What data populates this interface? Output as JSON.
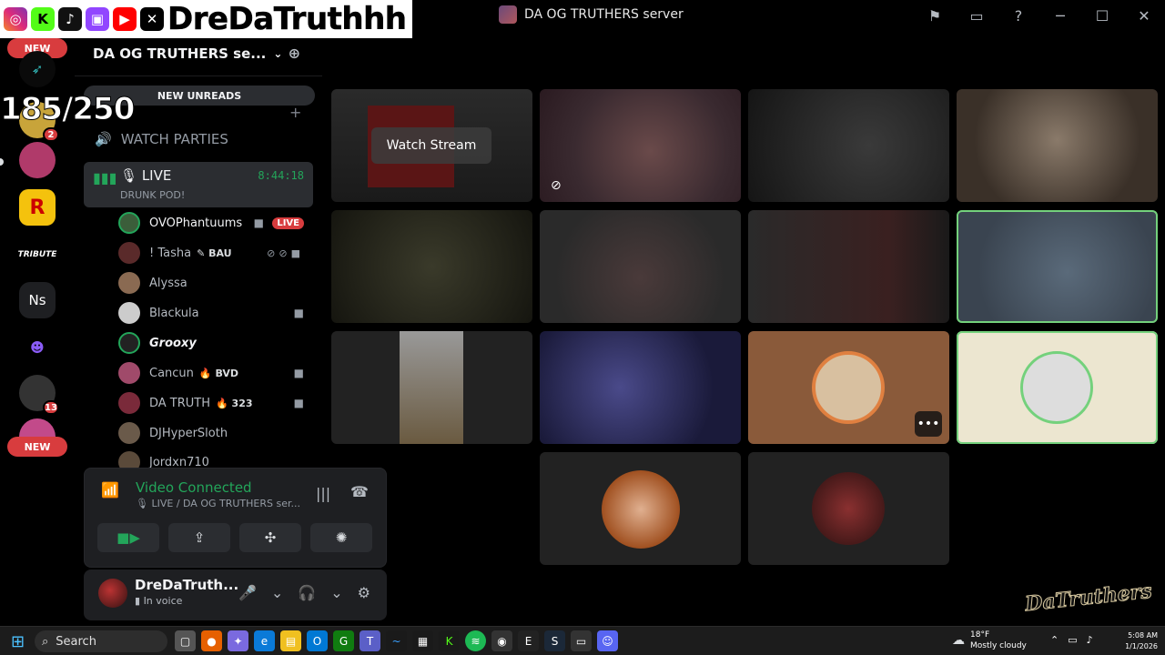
{
  "overlay": {
    "brand_name": "DreDaTruthhh",
    "socials": [
      {
        "icon": "instagram-icon",
        "label": "IG",
        "color": "#d6249f"
      },
      {
        "icon": "kick-icon",
        "label": "K",
        "color": "#53fc18"
      },
      {
        "icon": "tiktok-icon",
        "label": "♪",
        "color": "#111111"
      },
      {
        "icon": "twitch-icon",
        "label": "t",
        "color": "#9146ff"
      },
      {
        "icon": "youtube-icon",
        "label": "▶",
        "color": "#ff0000"
      },
      {
        "icon": "x-icon",
        "label": "𝕏",
        "color": "#000000"
      }
    ],
    "viewer_count": "185/250"
  },
  "window": {
    "title": "DA OG TRUTHERS server"
  },
  "rail": {
    "new_top": "NEW",
    "new_bottom": "NEW",
    "badges": [
      "2",
      "13"
    ],
    "items": [
      "Ns",
      "TRIBUTE"
    ]
  },
  "sidebar": {
    "server_name": "DA OG TRUTHERS se...",
    "new_unreads": "NEW UNREADS",
    "category": "WATCH PARTIES",
    "live_channel": {
      "name": "LIVE",
      "subtitle": "DRUNK POD!",
      "timer": "8:44:18"
    },
    "members": [
      {
        "name": "OVOPhantuums",
        "tag": "",
        "badge": "LIVE",
        "cam": true
      },
      {
        "name": "! Tasha",
        "tag": "BAU",
        "badge": "",
        "cam": true
      },
      {
        "name": "Alyssa",
        "tag": "",
        "badge": "",
        "cam": false
      },
      {
        "name": "Blackula",
        "tag": "",
        "badge": "",
        "cam": true
      },
      {
        "name": "Grooxy",
        "tag": "",
        "badge": "",
        "cam": false
      },
      {
        "name": "Cancun",
        "tag": "BVD",
        "badge": "",
        "cam": true
      },
      {
        "name": "DA TRUTH",
        "tag": "323",
        "badge": "",
        "cam": true
      },
      {
        "name": "DJHyperSloth",
        "tag": "",
        "badge": "",
        "cam": false
      },
      {
        "name": "Jordxn710",
        "tag": "",
        "badge": "",
        "cam": false
      }
    ]
  },
  "voice": {
    "status": "Video Connected",
    "location": "LIVE / DA OG TRUTHERS ser..."
  },
  "user": {
    "name": "DreDaTruth...",
    "status": "In voice"
  },
  "stream": {
    "watch_label": "Watch Stream"
  },
  "taskbar": {
    "search": "Search",
    "temp": "18°F",
    "weather": "Mostly cloudy",
    "time": "5:08 AM",
    "date": "1/1/2026"
  },
  "watermark": "DaTruthers"
}
